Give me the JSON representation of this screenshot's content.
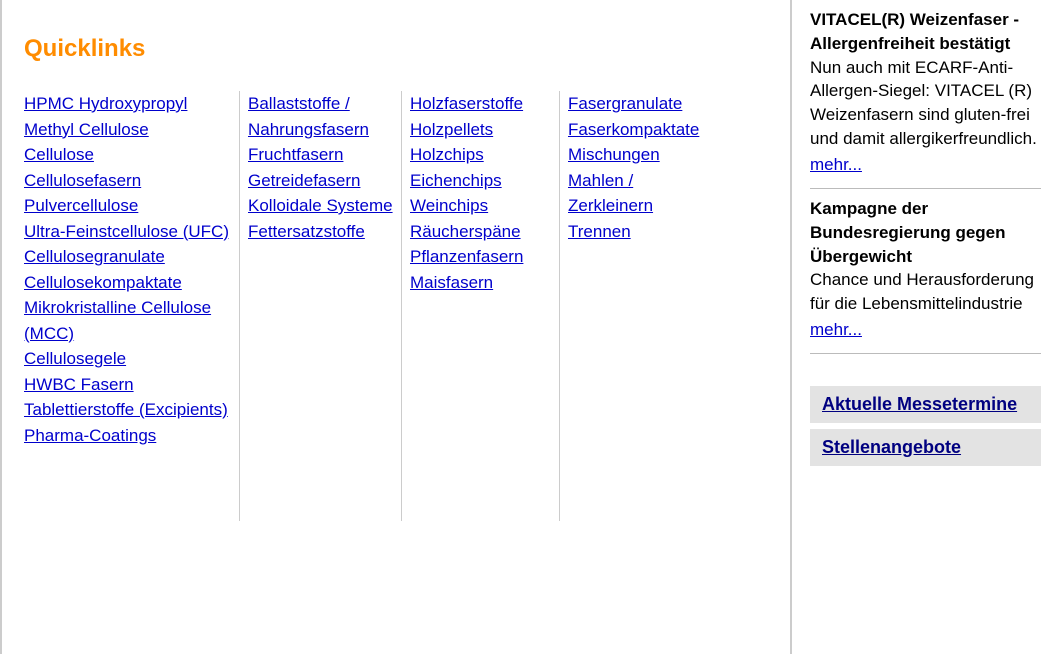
{
  "main": {
    "sectionTitle": "Quicklinks",
    "columns": [
      [
        "HPMC Hydroxypropyl Methyl Cellulose",
        "Cellulose",
        "Cellulosefasern",
        "Pulvercellulose",
        "Ultra-Feinstcellulose (UFC)",
        "Cellulosegranulate",
        "Cellulosekompaktate",
        "Mikrokristalline Cellulose (MCC)",
        "Cellulosegele",
        "HWBC Fasern",
        "Tablettierstoffe (Excipients)",
        "Pharma-Coatings"
      ],
      [
        "Ballaststoffe / Nahrungsfasern",
        "Fruchtfasern",
        "Getreidefasern",
        "Kolloidale Systeme",
        "Fettersatzstoffe"
      ],
      [
        "Holzfaserstoffe",
        "Holzpellets",
        "Holzchips",
        "Eichenchips",
        "Weinchips",
        "Räucherspäne",
        "Pflanzenfasern",
        "Maisfasern"
      ],
      [
        "Fasergranulate",
        "Faserkompaktate",
        "Mischungen",
        "Mahlen / Zerkleinern",
        "Trennen"
      ]
    ]
  },
  "sidebar": {
    "news": [
      {
        "title": "VITACEL(R) Weizenfaser - Allergenfreiheit bestätigt",
        "body": "Nun auch mit ECARF-Anti-Allergen-Siegel: VITACEL (R) Weizenfasern sind gluten-frei und damit allergikerfreundlich.",
        "more": "mehr..."
      },
      {
        "title": "Kampagne der Bundesregierung gegen Übergewicht",
        "body": "Chance und Herausforderung für die Lebensmittelindustrie",
        "more": "mehr..."
      }
    ],
    "boxLinks": [
      "Aktuelle Messetermine",
      "Stellenangebote"
    ]
  }
}
